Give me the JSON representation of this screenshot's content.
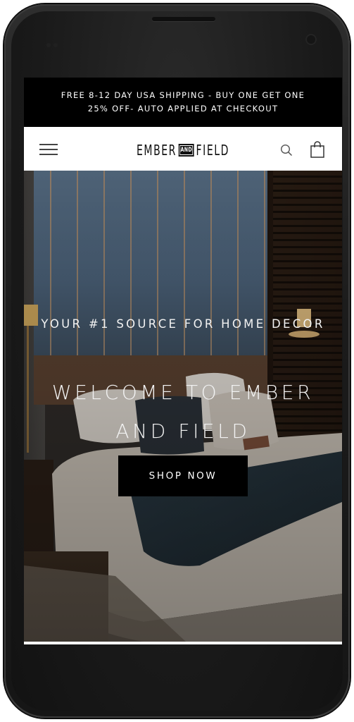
{
  "announcement": {
    "line1": "FREE 8-12 DAY USA SHIPPING - BUY ONE GET ONE",
    "line2": "25% OFF- AUTO APPLIED AT CHECKOUT"
  },
  "header": {
    "logo_left": "EMBER",
    "logo_and": "AND",
    "logo_right": "FIELD",
    "icons": [
      "menu-icon",
      "search-icon",
      "shopping-bag-icon"
    ]
  },
  "hero": {
    "tagline": "YOUR #1 SOURCE FOR HOME DECOR",
    "headline": "WELCOME TO EMBER AND FIELD",
    "cta_label": "SHOP NOW"
  },
  "colors": {
    "announcement_bg": "#000000",
    "header_bg": "#ffffff",
    "cta_bg": "#000000",
    "text_light": "#f2f2f2"
  }
}
